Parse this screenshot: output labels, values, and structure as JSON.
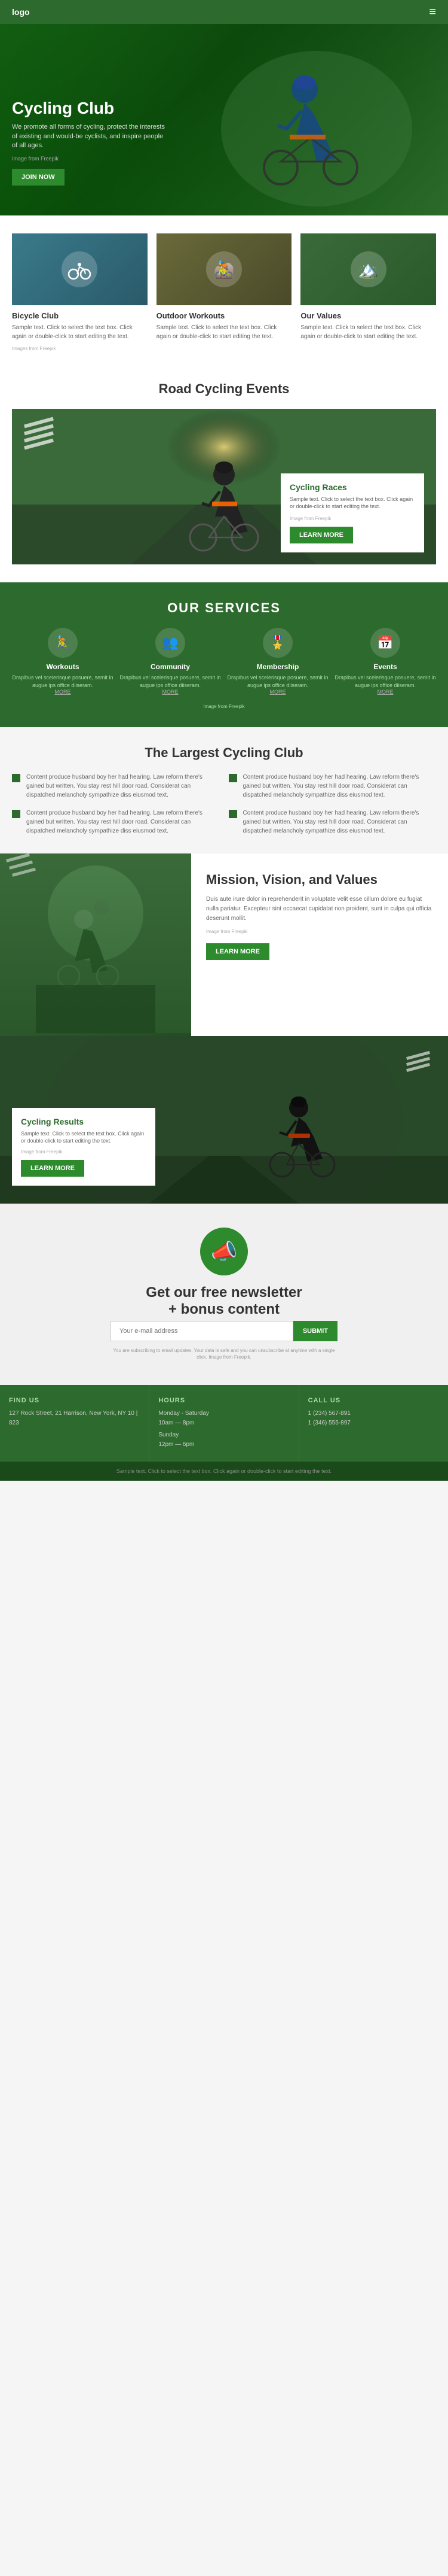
{
  "nav": {
    "logo": "logo",
    "hamburger": "≡"
  },
  "hero": {
    "title": "Cycling Club",
    "description": "We promote all forms of cycling, protect the interests of existing and would-be cyclists, and inspire people of all ages.",
    "img_credit": "Image from Freepik",
    "cta_label": "JOIN NOW"
  },
  "cards": [
    {
      "title": "Bicycle Club",
      "description": "Sample text. Click to select the text box. Click again or double-click to start editing the text.",
      "img_credit": "Images from Freepik"
    },
    {
      "title": "Outdoor Workouts",
      "description": "Sample text. Click to select the text box. Click again or double-click to start editing the text.",
      "img_credit": ""
    },
    {
      "title": "Our Values",
      "description": "Sample text. Click to select the text box. Click again or double-click to start editing the text.",
      "img_credit": ""
    }
  ],
  "cards_img_credit": "Images from Freepik",
  "events": {
    "section_title": "Road Cycling Events",
    "card_title": "Cycling Races",
    "card_text": "Sample text. Click to select the text box. Click again or double-click to start editing the text.",
    "img_credit": "Image from Freepik",
    "learn_more": "LEARN MORE"
  },
  "services": {
    "section_title": "OUR SERVICES",
    "items": [
      {
        "icon": "🚴",
        "title": "Workouts",
        "description": "Drapibus vel scelerisque posuere, semit in augue ips office diiseram."
      },
      {
        "icon": "👥",
        "title": "Community",
        "description": "Drapibus vel scelerisque posuere, semit in augue ips office diiseram."
      },
      {
        "icon": "🎖️",
        "title": "Membership",
        "description": "Drapibus vel scelerisque posuere, semit in augue ips office diiseram."
      },
      {
        "icon": "📅",
        "title": "Events",
        "description": "Drapibus vel scelerisque posuere, semit in augue ips office diiseram."
      }
    ],
    "more_label": "MORE",
    "img_credit": "Image from Freepik"
  },
  "largest": {
    "section_title": "The Largest Cycling Club",
    "items": [
      "Content produce husband boy her had hearing. Law reform there's gained but written. You stay rest hill door road. Considerat can dispatched melancholy sympathize diss eiusmod text.",
      "Content produce husband boy her had hearing. Law reform there's gained but written. You stay rest hill door road. Considerat can dispatched melancholy sympathize diss eiusmod text.",
      "Content produce husband boy her had hearing. Law reform there's gained but written. You stay rest hill door road. Considerat can dispatched melancholy sympathize diss eiusmod text.",
      "Content produce husband boy her had hearing. Law reform there's gained but written. You stay rest hill door road. Considerat can dispatched melancholy sympathize diss eiusmod text."
    ]
  },
  "mission": {
    "section_title": "Mission, Vision, and Values",
    "text": "Duis aute irure dolor in reprehenderit in voluptate velit esse cillum dolore eu fugiat nulla pariatur. Excepteur sint occaecat cupidatat non proident, sunt in culpa qui officia deserunt mollit.",
    "img_credit": "Image from Freepik",
    "learn_more": "LEARN MORE"
  },
  "results": {
    "card_title": "Cycling Results",
    "card_text": "Sample text. Click to select the text box. Click again or double-click to start editing the text.",
    "img_credit": "Image from Freepik",
    "learn_more": "LEARN MORE"
  },
  "newsletter": {
    "title_line1": "Get our free newsletter",
    "title_line2": "+ bonus content",
    "input_placeholder": "Your e-mail address",
    "submit_label": "SUBMIT",
    "disclaimer": "You are subscribing to email updates. Your data is safe and you can unsubscribe at anytime with a single click. Image from Freepik."
  },
  "footer": {
    "find_us": {
      "heading": "FIND US",
      "address": "127 Rock Street, 21 Harrison, New York, NY 10 | 823"
    },
    "hours": {
      "heading": "HOURS",
      "mon_sat_label": "Monday - Saturday",
      "mon_sat_hours": "10am — 8pm",
      "sun_label": "Sunday",
      "sun_hours": "12pm — 6pm"
    },
    "call_us": {
      "heading": "CALL US",
      "phone1": "1 (234) 567-891",
      "phone2": "1 (346) 555-897"
    }
  },
  "footer_bottom": {
    "text": "Sample text. Click to select the text box. Click again or double-click to start editing the text."
  }
}
